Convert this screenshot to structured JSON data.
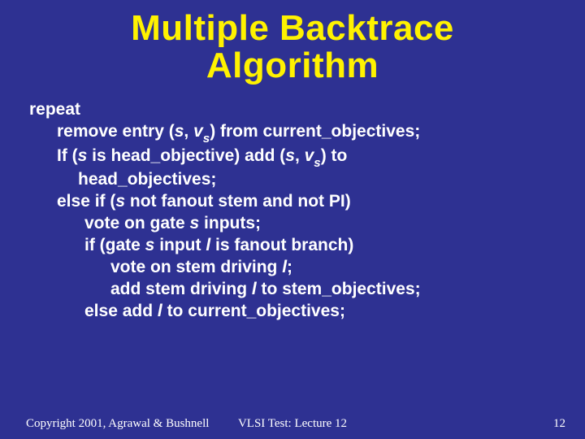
{
  "title_line1": "Multiple Backtrace",
  "title_line2": "Algorithm",
  "algo": {
    "l0": "repeat",
    "l1_a": "remove entry (",
    "l1_s": "s",
    "l1_b": ", ",
    "l1_v": "v",
    "l1_sub": "s",
    "l1_c": ") from current_objectives;",
    "l2_a": "If (",
    "l2_s": "s",
    "l2_b": " is head_objective) add (",
    "l2_s2": "s",
    "l2_c": ", ",
    "l2_v": "v",
    "l2_sub": "s",
    "l2_d": ") to",
    "l2cont": "head_objectives;",
    "l3_a": "else if (",
    "l3_s": "s",
    "l3_b": " not fanout stem and not PI)",
    "l4_a": "vote on gate ",
    "l4_s": "s",
    "l4_b": " inputs;",
    "l5_a": "if (gate ",
    "l5_s": "s",
    "l5_b": " input ",
    "l5_l": "l",
    "l5_c": " is fanout branch)",
    "l6_a": "vote on stem driving ",
    "l6_l": "l",
    "l6_b": ";",
    "l7_a": "add stem driving ",
    "l7_l": "l",
    "l7_b": " to stem_objectives;",
    "l8_a": "else add ",
    "l8_l": "l",
    "l8_b": " to current_objectives;"
  },
  "footer": {
    "left": "Copyright 2001, Agrawal & Bushnell",
    "center": "VLSI Test: Lecture 12",
    "right": "12"
  }
}
